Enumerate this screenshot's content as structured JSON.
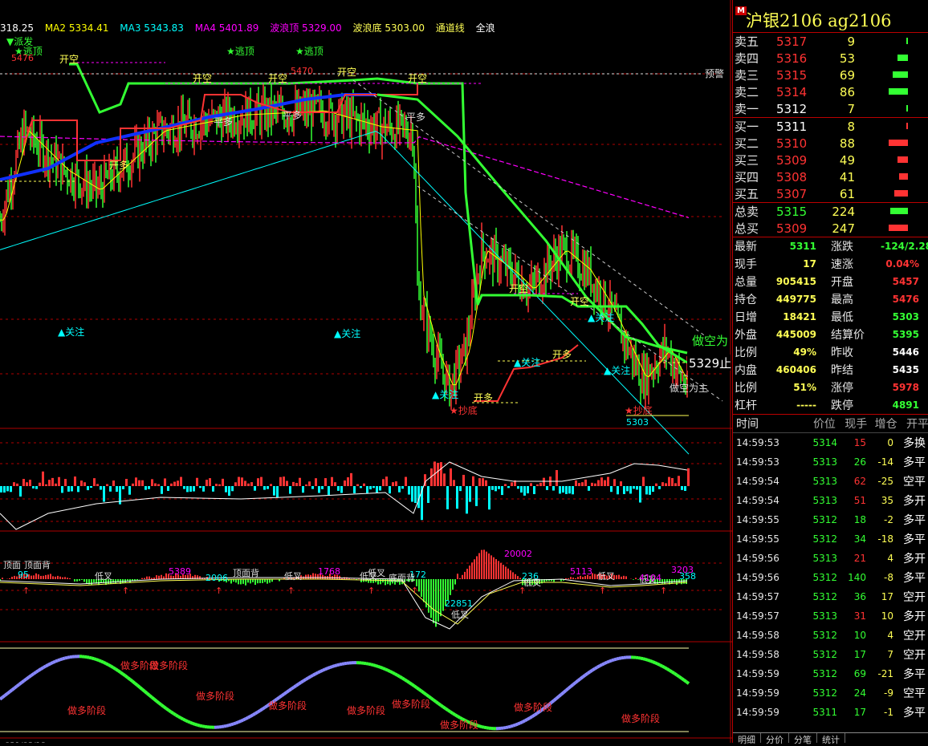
{
  "colors": {
    "up": "#ff3333",
    "down": "#33ff33",
    "ma1": "#ffffff",
    "ma2": "#ffff00",
    "ma3": "#00ffff",
    "ma4": "#ff00ff",
    "border": "#b00000",
    "label_yellow": "#ffff55"
  },
  "ma_bar": {
    "ma1": "318.25",
    "ma2": "MA2 5334.41",
    "ma3": "MA3 5343.83",
    "ma4": "MA4 5401.89",
    "wave_top": "波浪顶 5329.00",
    "wave_bottom": "波浪底 5303.00",
    "channel": "通道线",
    "full_wave": "全浪"
  },
  "annotations": {
    "pai_fa": "▼派发",
    "tao_ding": "★逃顶",
    "kai_kong": "开空",
    "kai_duo": "开多",
    "ping_duo": "平多",
    "guan_zhu": "▲关注",
    "chao_di": "★抄底",
    "yu_jing": "预警",
    "zuo_kong_wei_zhu": "做空为主",
    "zuo_kong_side": "做空为",
    "hi_5476": "5476",
    "hi_5470": "5470",
    "lo_5303": "5303",
    "stop_label": "5329止",
    "macd_labels": [
      "顶面",
      "顶面背",
      "95",
      "低叉",
      "5389",
      "2006",
      "顶面背",
      "低叉",
      "1768",
      "低叉",
      "172",
      "底面背",
      "低叉",
      "20002",
      "22851",
      "低叉",
      "236",
      "低叉",
      "5113",
      "低叉",
      "低叉",
      "4104",
      "3203",
      "358"
    ],
    "stage_labels": [
      "做多阶段",
      "做多阶段",
      "做多阶段",
      "做多阶段",
      "做多阶段",
      "做多阶段",
      "做多阶段",
      "做多阶段",
      "做多阶段",
      "做多阶段"
    ],
    "date_fragment": "021/03/19"
  },
  "title": {
    "badge": "M",
    "name": "沪银2106  ag2106"
  },
  "orderbook": {
    "asks": [
      {
        "label": "卖五",
        "price": "5317",
        "vol": "9",
        "bar": 0.05
      },
      {
        "label": "卖四",
        "price": "5316",
        "vol": "53",
        "bar": 0.55
      },
      {
        "label": "卖三",
        "price": "5315",
        "vol": "69",
        "bar": 0.8
      },
      {
        "label": "卖二",
        "price": "5314",
        "vol": "86",
        "bar": 1.0
      },
      {
        "label": "卖一",
        "price": "5312",
        "vol": "7",
        "bar": 0.05
      }
    ],
    "bids": [
      {
        "label": "买一",
        "price": "5311",
        "vol": "8",
        "bar": 0.05
      },
      {
        "label": "买二",
        "price": "5310",
        "vol": "88",
        "bar": 1.0
      },
      {
        "label": "买三",
        "price": "5309",
        "vol": "49",
        "bar": 0.55
      },
      {
        "label": "买四",
        "price": "5308",
        "vol": "41",
        "bar": 0.45
      },
      {
        "label": "买五",
        "price": "5307",
        "vol": "61",
        "bar": 0.7
      }
    ],
    "totals": [
      {
        "label": "总卖",
        "price": "5315",
        "vol": "224",
        "bar": 0.9,
        "color": "#33ff33"
      },
      {
        "label": "总买",
        "price": "5309",
        "vol": "247",
        "bar": 1.0,
        "color": "#ff3333"
      }
    ]
  },
  "quote": [
    {
      "k": "最新",
      "v": "5311",
      "vc": "#33ff33",
      "k2": "涨跌",
      "v2": "-124/2.28%",
      "v2c": "#33ff33"
    },
    {
      "k": "现手",
      "v": "17",
      "vc": "#ffff55",
      "k2": "速涨",
      "v2": "0.04%",
      "v2c": "#ff3333"
    },
    {
      "k": "总量",
      "v": "905415",
      "vc": "#ffff55",
      "k2": "开盘",
      "v2": "5457",
      "v2c": "#ff3333"
    },
    {
      "k": "持仓",
      "v": "449775",
      "vc": "#ffff55",
      "k2": "最高",
      "v2": "5476",
      "v2c": "#ff3333"
    },
    {
      "k": "日增",
      "v": "18421",
      "vc": "#ffff55",
      "k2": "最低",
      "v2": "5303",
      "v2c": "#33ff33"
    },
    {
      "k": "外盘",
      "v": "445009",
      "vc": "#ffff55",
      "k2": "结算价",
      "v2": "5395",
      "v2c": "#33ff33"
    },
    {
      "k": "比例",
      "v": "49%",
      "vc": "#ffff55",
      "k2": "昨收",
      "v2": "5446",
      "v2c": "#ffffff"
    },
    {
      "k": "内盘",
      "v": "460406",
      "vc": "#ffff55",
      "k2": "昨结",
      "v2": "5435",
      "v2c": "#ffffff"
    },
    {
      "k": "比例",
      "v": "51%",
      "vc": "#ffff55",
      "k2": "涨停",
      "v2": "5978",
      "v2c": "#ff3333"
    },
    {
      "k": "杠杆",
      "v": "-----",
      "vc": "#ffff55",
      "k2": "跌停",
      "v2": "4891",
      "v2c": "#33ff33"
    }
  ],
  "ticks_header": {
    "time": "时间",
    "price": "价位",
    "vol": "现手",
    "oi": "增仓",
    "type": "开平"
  },
  "ticks": [
    {
      "time": "14:59:53",
      "price": "5314",
      "vol": "15",
      "vc": "#ff3333",
      "oi": "0",
      "type": "多换",
      "tc": "#ffffff"
    },
    {
      "time": "14:59:53",
      "price": "5313",
      "vol": "26",
      "vc": "#33ff33",
      "oi": "-14",
      "type": "多平",
      "tc": "#ffffff"
    },
    {
      "time": "14:59:54",
      "price": "5313",
      "vol": "62",
      "vc": "#ff3333",
      "oi": "-25",
      "type": "空平",
      "tc": "#ffffff"
    },
    {
      "time": "14:59:54",
      "price": "5313",
      "vol": "51",
      "vc": "#ff3333",
      "oi": "35",
      "type": "多开",
      "tc": "#ffffff"
    },
    {
      "time": "14:59:55",
      "price": "5312",
      "vol": "18",
      "vc": "#33ff33",
      "oi": "-2",
      "type": "多平",
      "tc": "#ffffff"
    },
    {
      "time": "14:59:55",
      "price": "5312",
      "vol": "34",
      "vc": "#33ff33",
      "oi": "-18",
      "type": "多平",
      "tc": "#ffffff"
    },
    {
      "time": "14:59:56",
      "price": "5313",
      "vol": "21",
      "vc": "#ff3333",
      "oi": "4",
      "type": "多开",
      "tc": "#ffffff"
    },
    {
      "time": "14:59:56",
      "price": "5312",
      "vol": "140",
      "vc": "#33ff33",
      "oi": "-8",
      "type": "多平",
      "tc": "#ffffff"
    },
    {
      "time": "14:59:57",
      "price": "5312",
      "vol": "36",
      "vc": "#33ff33",
      "oi": "17",
      "type": "空开",
      "tc": "#ffffff"
    },
    {
      "time": "14:59:57",
      "price": "5313",
      "vol": "31",
      "vc": "#ff3333",
      "oi": "10",
      "type": "多开",
      "tc": "#ffffff"
    },
    {
      "time": "14:59:58",
      "price": "5312",
      "vol": "10",
      "vc": "#33ff33",
      "oi": "4",
      "type": "空开",
      "tc": "#ffffff"
    },
    {
      "time": "14:59:58",
      "price": "5312",
      "vol": "17",
      "vc": "#33ff33",
      "oi": "7",
      "type": "空开",
      "tc": "#ffffff"
    },
    {
      "time": "14:59:59",
      "price": "5312",
      "vol": "69",
      "vc": "#33ff33",
      "oi": "-21",
      "type": "多平",
      "tc": "#ffffff"
    },
    {
      "time": "14:59:59",
      "price": "5312",
      "vol": "24",
      "vc": "#33ff33",
      "oi": "-9",
      "type": "空平",
      "tc": "#ffffff"
    },
    {
      "time": "14:59:59",
      "price": "5311",
      "vol": "17",
      "vc": "#33ff33",
      "oi": "-1",
      "type": "多平",
      "tc": "#ffffff"
    }
  ],
  "tabs": [
    "明细",
    "分价",
    "分笔",
    "统计"
  ],
  "chart_data": {
    "type": "line",
    "title": "沪银2106 ag2106",
    "ylim": [
      5290,
      5480
    ],
    "series": [
      {
        "name": "MA2",
        "values": [
          5335,
          5350,
          5370,
          5385,
          5395,
          5400,
          5395,
          5360,
          5345,
          5340,
          5338,
          5336,
          5334
        ]
      },
      {
        "name": "MA3",
        "values": [
          5340,
          5355,
          5372,
          5384,
          5392,
          5398,
          5396,
          5380,
          5360,
          5350,
          5346,
          5344,
          5344
        ]
      },
      {
        "name": "MA4",
        "values": [
          5400,
          5405,
          5410,
          5412,
          5414,
          5416,
          5418,
          5414,
          5410,
          5406,
          5404,
          5403,
          5402
        ]
      }
    ],
    "wave_top": 5329.0,
    "wave_bottom": 5303.0,
    "high": 5476,
    "low": 5303
  }
}
